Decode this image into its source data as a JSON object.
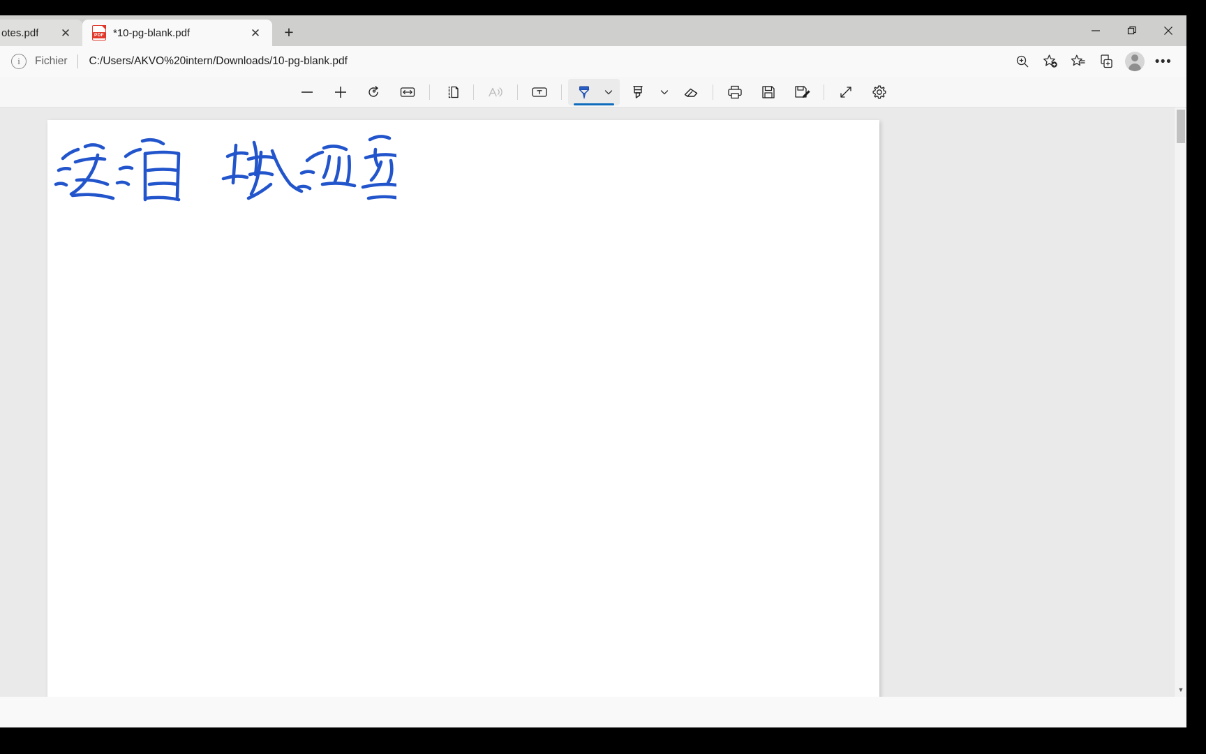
{
  "window": {
    "controls": [
      {
        "name": "minimize",
        "label": "Minimize"
      },
      {
        "name": "restore",
        "label": "Restore"
      },
      {
        "name": "close",
        "label": "Close"
      }
    ]
  },
  "tabs": [
    {
      "title": "otes.pdf",
      "active": false,
      "has_pdf_icon": false,
      "close_label": "✕"
    },
    {
      "title": "*10-pg-blank.pdf",
      "active": true,
      "has_pdf_icon": true,
      "close_label": "✕",
      "icon_text": "PDF"
    }
  ],
  "new_tab_label": "+",
  "address_bar": {
    "info_icon_glyph": "i",
    "scheme_label": "Fichier",
    "separator": "|",
    "url": "C:/Users/AKVO%20intern/Downloads/10-pg-blank.pdf",
    "actions": [
      {
        "name": "zoom-search-icon",
        "title": "Rechercher"
      },
      {
        "name": "add-favorite-icon",
        "title": "Ajouter aux favoris"
      },
      {
        "name": "favorites-icon",
        "title": "Favoris"
      },
      {
        "name": "collections-icon",
        "title": "Collections"
      },
      {
        "name": "profile-avatar",
        "title": "Profil"
      },
      {
        "name": "more-options-icon",
        "title": "Paramètres et plus",
        "glyph": "•••"
      }
    ]
  },
  "pdf_toolbar": {
    "items": [
      {
        "name": "zoom-out-icon",
        "title": "Zoom arrière",
        "state": "enabled"
      },
      {
        "name": "zoom-in-icon",
        "title": "Zoom avant",
        "state": "enabled"
      },
      {
        "name": "rotate-icon",
        "title": "Faire pivoter",
        "state": "enabled"
      },
      {
        "name": "fit-to-width-icon",
        "title": "Ajuster à la page",
        "state": "enabled"
      },
      {
        "name": "page-view-icon",
        "title": "Affichage de page",
        "state": "enabled"
      },
      {
        "name": "read-aloud-icon",
        "title": "Lecture à voix haute",
        "state": "disabled"
      },
      {
        "name": "add-text-icon",
        "title": "Ajouter du texte",
        "state": "enabled"
      },
      {
        "name": "draw-pen-icon",
        "title": "Dessiner",
        "state": "selected"
      },
      {
        "name": "pen-options-chevron-icon",
        "title": "Options de dessin",
        "state": "enabled"
      },
      {
        "name": "highlighter-icon",
        "title": "Surligner",
        "state": "enabled"
      },
      {
        "name": "highlighter-options-chevron-icon",
        "title": "Options de surlignage",
        "state": "enabled"
      },
      {
        "name": "eraser-icon",
        "title": "Effacer",
        "state": "enabled"
      },
      {
        "name": "print-icon",
        "title": "Imprimer",
        "state": "enabled"
      },
      {
        "name": "save-icon",
        "title": "Enregistrer",
        "state": "enabled"
      },
      {
        "name": "save-as-icon",
        "title": "Enregistrer sous",
        "state": "enabled"
      },
      {
        "name": "expand-icon",
        "title": "Plein écran",
        "state": "enabled"
      },
      {
        "name": "settings-gear-icon",
        "title": "Paramètres",
        "state": "enabled"
      }
    ]
  },
  "viewer": {
    "page_background": "#ffffff",
    "viewer_background": "#eaeaea",
    "annotation": {
      "description": "Handwritten blue ink Chinese characters near top-left of the page",
      "ink_color": "#2255cc",
      "stroke_width": 5
    },
    "scrollbar": {
      "thumb_position": "top",
      "down_arrow_glyph": "▼"
    }
  },
  "colors": {
    "accent": "#0f6cbd",
    "tabstrip": "#cfd0cd",
    "ink_blue": "#2255cc",
    "pdf_red": "#e0392c"
  }
}
